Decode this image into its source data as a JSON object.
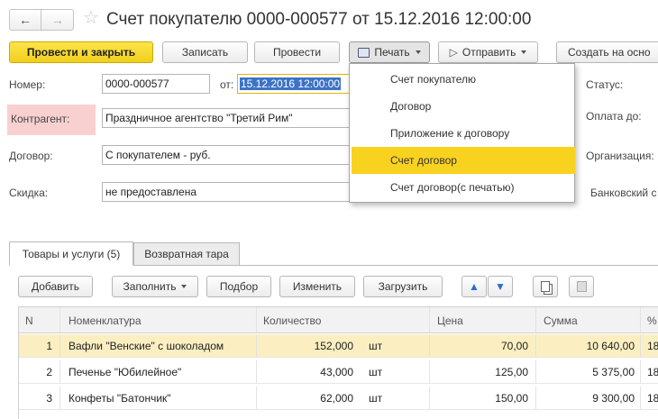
{
  "window": {
    "title": "Счет покупателю 0000-000577 от 15.12.2016 12:00:00"
  },
  "toolbar": {
    "post_and_close": "Провести и закрыть",
    "save": "Записать",
    "post": "Провести",
    "print": "Печать",
    "send": "Отправить",
    "create_based_on": "Создать на осно"
  },
  "print_menu": {
    "items": [
      "Счет покупателю",
      "Договор",
      "Приложение к договору",
      "Счет договор",
      "Счет договор(с печатью)"
    ],
    "highlighted_index": 3
  },
  "form": {
    "number_label": "Номер:",
    "number_value": "0000-000577",
    "date_label": "от:",
    "date_value": "15.12.2016 12:00:00",
    "counterparty_label": "Контрагент:",
    "counterparty_value": "Праздничное агентство \"Третий Рим\"",
    "contract_label": "Договор:",
    "contract_value": "С покупателем - руб.",
    "discount_label": "Скидка:",
    "discount_value": "не предоставлена",
    "status_label": "Статус:",
    "payment_until_label": "Оплата до:",
    "organization_label": "Организация:",
    "bank_account_label": "Банковский с"
  },
  "tabs": {
    "goods": "Товары и услуги (5)",
    "returnable": "Возвратная тара"
  },
  "table_toolbar": {
    "add": "Добавить",
    "fill": "Заполнить",
    "pick": "Подбор",
    "change": "Изменить",
    "load": "Загрузить"
  },
  "table": {
    "headers": {
      "n": "N",
      "item": "Номенклатура",
      "qty": "Количество",
      "price": "Цена",
      "sum": "Сумма",
      "vat": "%"
    },
    "rows": [
      {
        "n": "1",
        "item": "Вафли \"Венские\" с шоколадом",
        "qty": "152,000",
        "unit": "шт",
        "price": "70,00",
        "sum": "10 640,00",
        "vat": "18"
      },
      {
        "n": "2",
        "item": "Печенье \"Юбилейное\"",
        "qty": "43,000",
        "unit": "шт",
        "price": "125,00",
        "sum": "5 375,00",
        "vat": "18"
      },
      {
        "n": "3",
        "item": "Конфеты \"Батончик\"",
        "qty": "62,000",
        "unit": "шт",
        "price": "150,00",
        "sum": "9 300,00",
        "vat": "18"
      }
    ]
  },
  "colors": {
    "primary_button": "#f5d426",
    "menu_highlight": "#f9d11f",
    "active_row": "#fbefc2",
    "counterparty_label_bg": "#f9d0d0",
    "selection": "#3d73c5"
  }
}
